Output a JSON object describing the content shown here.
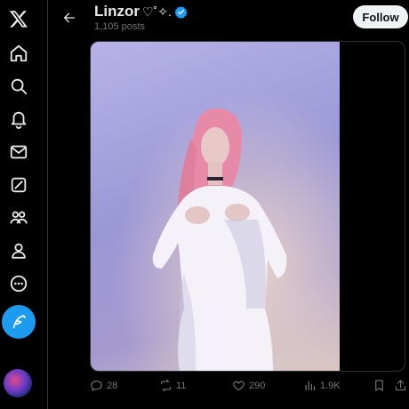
{
  "header": {
    "profile_name": "Linzor",
    "name_decor": "♡˚✧.",
    "posts_count": "1,105 posts",
    "follow_label": "Follow"
  },
  "sidebar": {
    "items": [
      {
        "name": "x-logo-icon"
      },
      {
        "name": "home-icon"
      },
      {
        "name": "search-icon"
      },
      {
        "name": "notifications-icon"
      },
      {
        "name": "messages-icon"
      },
      {
        "name": "grok-icon"
      },
      {
        "name": "communities-icon"
      },
      {
        "name": "profile-icon"
      },
      {
        "name": "more-icon"
      }
    ],
    "compose_icon": "compose-feather-icon"
  },
  "actions": {
    "replies": "28",
    "reposts": "11",
    "likes": "290",
    "views": "1.9K"
  },
  "colors": {
    "accent": "#1d9bf0",
    "background": "#000000",
    "secondary_text": "#71767b"
  }
}
